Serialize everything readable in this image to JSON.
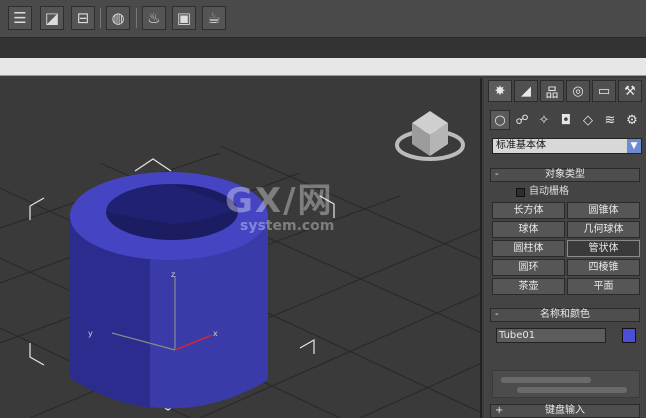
{
  "toolbar": {
    "buttons": [
      "layer-manager-icon",
      "curve-editor-icon",
      "schematic-view-icon",
      "material-editor-icon",
      "render-setup-icon",
      "rendered-frame-icon",
      "render-production-icon"
    ]
  },
  "viewport": {
    "watermark": "GX/网",
    "watermark_sub": "system.com",
    "axes": {
      "z": "z",
      "x": "x",
      "y": "y"
    },
    "object_color": "#3d3db8"
  },
  "panel": {
    "tabs": [
      "create-icon",
      "modify-icon",
      "hierarchy-icon",
      "motion-icon",
      "display-icon",
      "utilities-icon"
    ],
    "subtabs": [
      "geometry-icon",
      "shapes-icon",
      "lights-icon",
      "cameras-icon",
      "helpers-icon",
      "spacewarps-icon",
      "systems-icon"
    ],
    "category_dropdown": "标准基本体",
    "object_type": {
      "title": "对象类型",
      "sign": "-",
      "autogrid_label": "自动栅格",
      "buttons": [
        "长方体",
        "圆锥体",
        "球体",
        "几何球体",
        "圆柱体",
        "管状体",
        "圆环",
        "四棱锥",
        "茶壶",
        "平面"
      ],
      "active_button": "管状体"
    },
    "name_color": {
      "title": "名称和颜色",
      "sign": "-",
      "name_value": "Tube01",
      "color": "#4d4dd6"
    },
    "keyboard_entry": {
      "title": "键盘输入",
      "sign": "+"
    }
  }
}
